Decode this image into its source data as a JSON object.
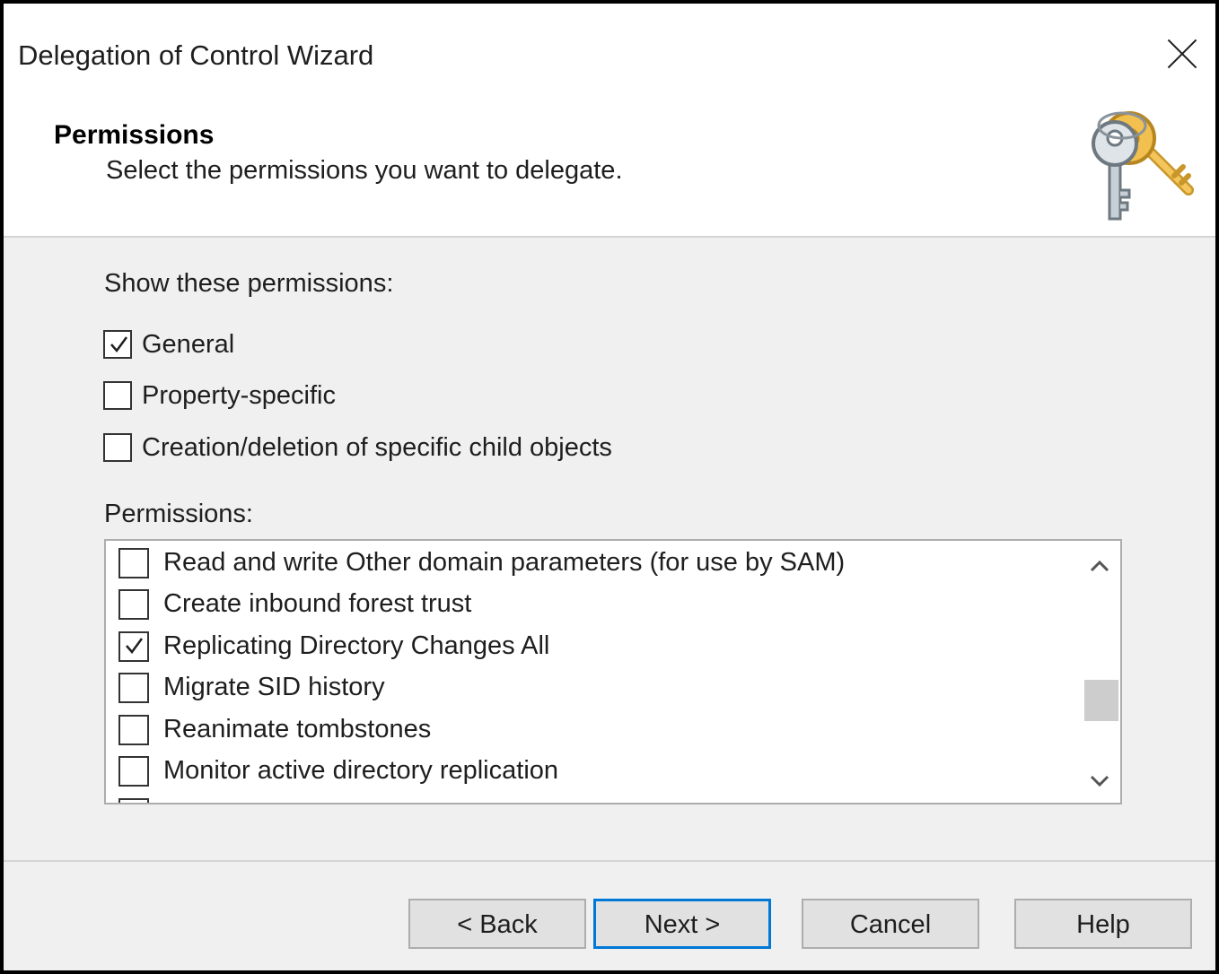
{
  "window": {
    "title": "Delegation of Control Wizard"
  },
  "header": {
    "title": "Permissions",
    "subtitle": "Select the permissions you want to delegate.",
    "icon": "keys-icon"
  },
  "filter": {
    "label": "Show these permissions:",
    "options": [
      {
        "label": "General",
        "checked": true
      },
      {
        "label": "Property-specific",
        "checked": false
      },
      {
        "label": "Creation/deletion of specific child objects",
        "checked": false
      }
    ]
  },
  "permissions": {
    "label": "Permissions:",
    "items": [
      {
        "label": "Read and write Other domain parameters (for use by SAM)",
        "checked": false
      },
      {
        "label": "Create inbound forest trust",
        "checked": false
      },
      {
        "label": "Replicating Directory Changes All",
        "checked": true
      },
      {
        "label": "Migrate SID history",
        "checked": false
      },
      {
        "label": "Reanimate tombstones",
        "checked": false
      },
      {
        "label": "Monitor active directory replication",
        "checked": false
      }
    ]
  },
  "buttons": {
    "back": "< Back",
    "next": "Next >",
    "cancel": "Cancel",
    "help": "Help"
  },
  "colors": {
    "accent": "#0078d7",
    "dialog_bg": "#f0f0f0",
    "header_bg": "#ffffff"
  }
}
